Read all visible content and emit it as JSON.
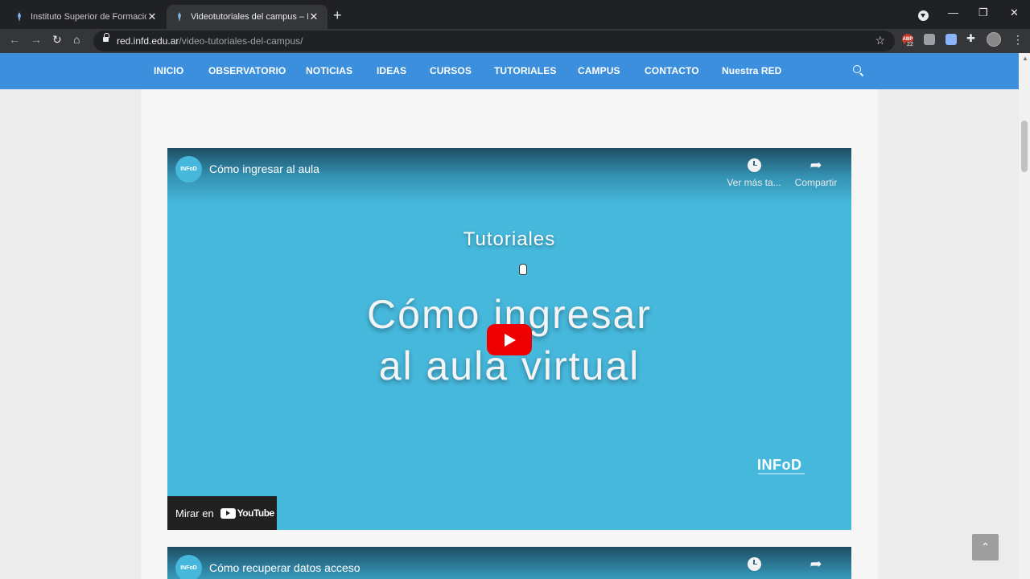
{
  "browser": {
    "tabs": [
      {
        "title": "Instituto Superior de Formación D",
        "active": false
      },
      {
        "title": "Videotutoriales del campus – Insti",
        "active": true
      }
    ],
    "new_tab_symbol": "+",
    "url_host": "red.infd.edu.ar",
    "url_path": "/video-tutoriales-del-campus/",
    "adblock_label": "ABP",
    "adblock_count": "22",
    "icons": [
      "back-icon",
      "forward-icon",
      "reload-icon",
      "home-icon",
      "lock-icon",
      "star-icon",
      "extensions-icon",
      "menu-icon"
    ]
  },
  "site": {
    "nav": [
      "INICIO",
      "OBSERVATORIO",
      "NOTICIAS",
      "IDEAS",
      "CURSOS",
      "TUTORIALES",
      "CAMPUS",
      "CONTACTO",
      "Nuestra RED"
    ],
    "accent_color": "#3b8fdc"
  },
  "videos": [
    {
      "title": "Cómo ingresar al aula",
      "channel_badge": "INFoD",
      "watch_later": "Ver más ta...",
      "share": "Compartir",
      "thumb_top": "Tutoriales",
      "thumb_line1": "Cómo ingresar",
      "thumb_line2": "al aula virtual",
      "brand": "INFoD",
      "watch_on": "Mirar en",
      "youtube": "YouTube"
    },
    {
      "title": "Cómo recuperar datos acceso",
      "channel_badge": "INFoD"
    }
  ],
  "scroll_top_symbol": "⌃"
}
